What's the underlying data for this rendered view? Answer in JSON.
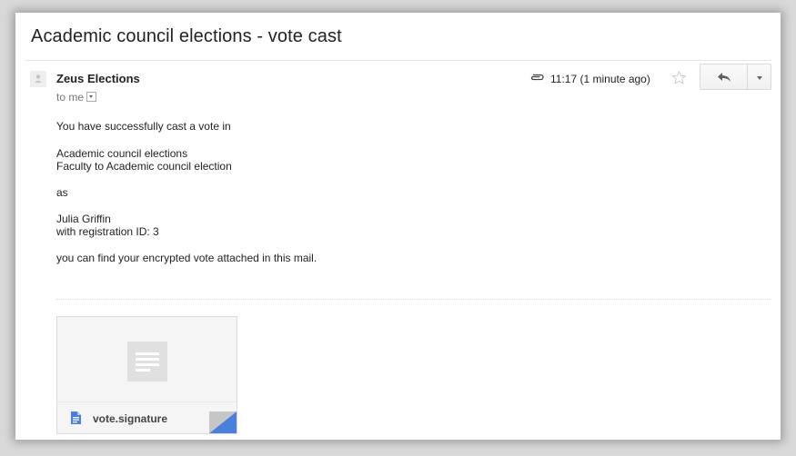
{
  "email": {
    "subject": "Academic council elections - vote cast",
    "sender": "Zeus Elections",
    "recipient": "to me",
    "timestamp": "11:17 (1 minute ago)",
    "body": {
      "line1": "You have successfully cast a vote in",
      "line2": "Academic council elections",
      "line3": "Faculty to Academic council election",
      "line4": "as",
      "line5": "Julia Griffin",
      "line6": "with registration ID: 3",
      "line7": "you can find your encrypted vote attached in this mail."
    },
    "attachment": {
      "filename": "vote.signature"
    }
  },
  "icons": {
    "avatar": "person-icon",
    "attachment": "paperclip-icon",
    "star": "star-icon",
    "reply": "reply-icon",
    "more": "chevron-down-icon",
    "file": "document-icon"
  },
  "colors": {
    "accent_blue": "#4a7fdc",
    "corner_gray": "#c6c6c6"
  }
}
